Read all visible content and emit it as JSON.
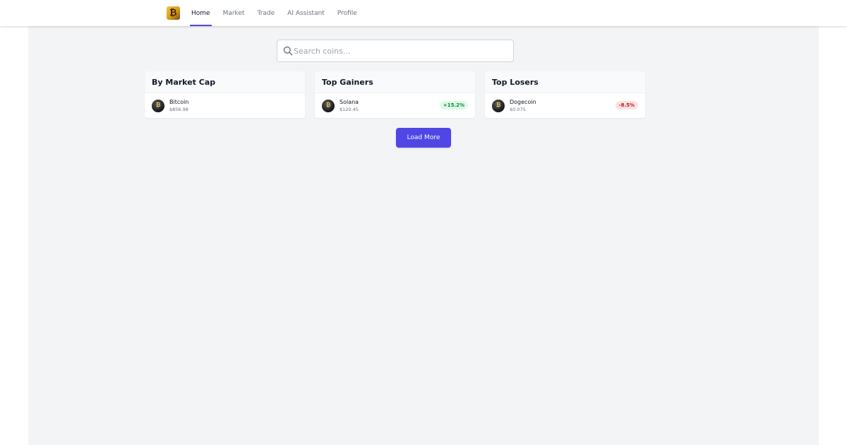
{
  "nav": {
    "logo_glyph": "₿",
    "tabs": [
      {
        "label": "Home",
        "active": true
      },
      {
        "label": "Market",
        "active": false
      },
      {
        "label": "Trade",
        "active": false
      },
      {
        "label": "AI Assistant",
        "active": false
      },
      {
        "label": "Profile",
        "active": false
      }
    ]
  },
  "search": {
    "placeholder": "Search coins...",
    "value": ""
  },
  "cards": [
    {
      "title": "By Market Cap",
      "coin": {
        "name": "Bitcoin",
        "price": "$856.98",
        "change": ""
      }
    },
    {
      "title": "Top Gainers",
      "coin": {
        "name": "Solana",
        "price": "$120.45",
        "change": "+15.2%"
      }
    },
    {
      "title": "Top Losers",
      "coin": {
        "name": "Dogecoin",
        "price": "$0.075",
        "change": "-8.5%"
      }
    }
  ],
  "load_more_label": "Load More",
  "colors": {
    "accent": "#4f46e5",
    "gain": "#15803d",
    "loss": "#b91c1c",
    "background": "#f3f4f6"
  }
}
